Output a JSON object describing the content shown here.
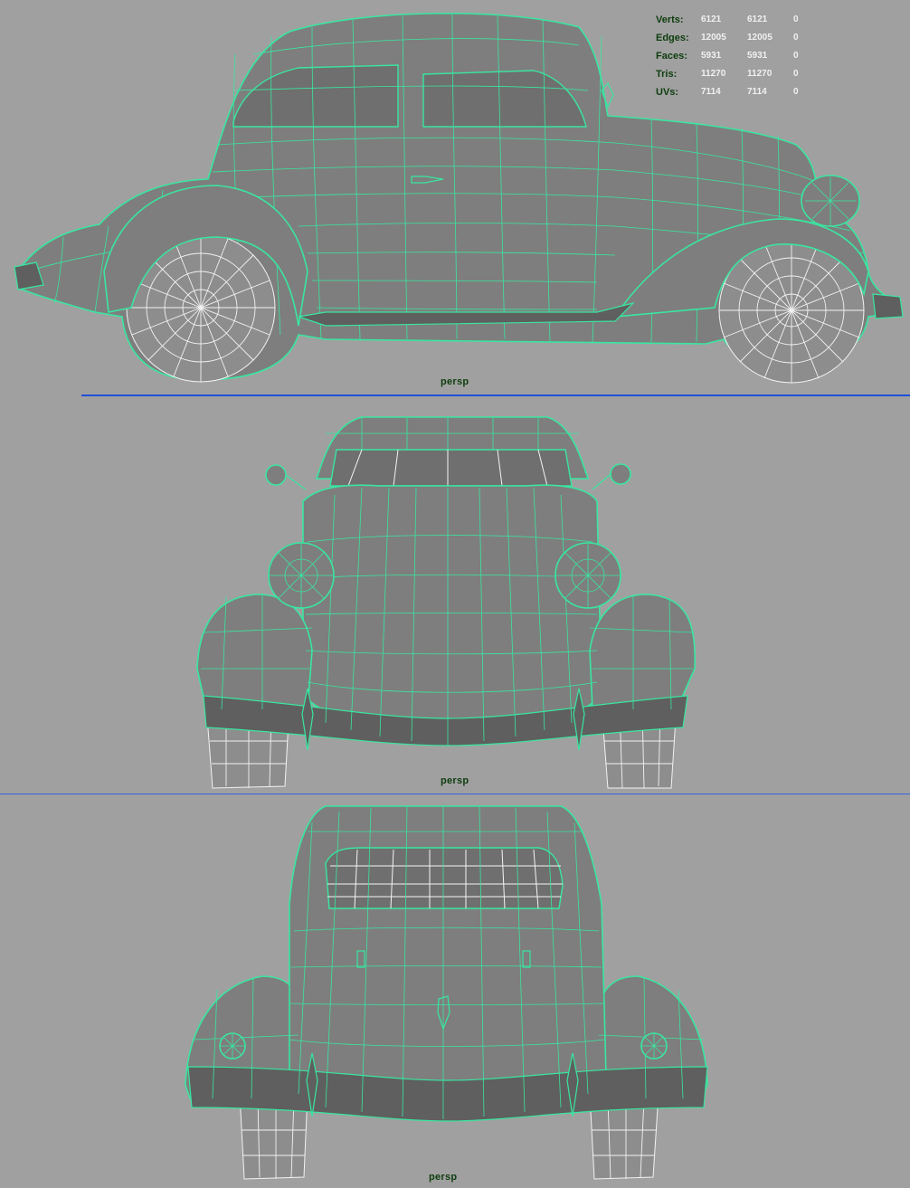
{
  "stats": {
    "rows": [
      {
        "label": "Verts:",
        "selected": "6121",
        "total": "6121",
        "extra": "0"
      },
      {
        "label": "Edges:",
        "selected": "12005",
        "total": "12005",
        "extra": "0"
      },
      {
        "label": "Faces:",
        "selected": "5931",
        "total": "5931",
        "extra": "0"
      },
      {
        "label": "Tris:",
        "selected": "11270",
        "total": "11270",
        "extra": "0"
      },
      {
        "label": "UVs:",
        "selected": "7114",
        "total": "7114",
        "extra": "0"
      }
    ]
  },
  "viewports": [
    {
      "camera": "persp"
    },
    {
      "camera": "persp"
    },
    {
      "camera": "persp"
    }
  ],
  "colors": {
    "background": "#a0a0a0",
    "wireframe": "#39e6a0",
    "divider": "#1f4fd8",
    "label": "#0d3d0d"
  }
}
